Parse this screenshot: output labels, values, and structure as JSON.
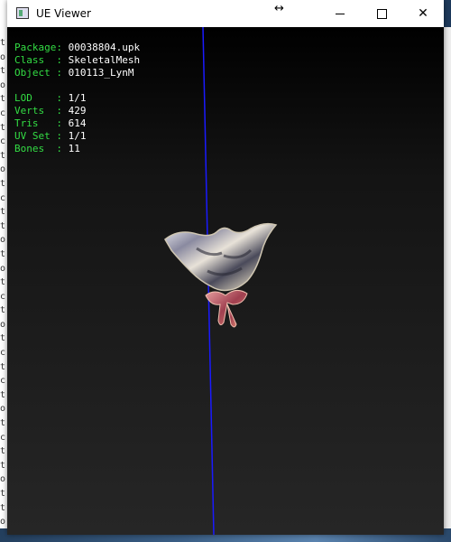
{
  "window": {
    "title": "UE Viewer",
    "controls": [
      "minimize",
      "maximize",
      "close"
    ]
  },
  "info_top": [
    {
      "key": "Package",
      "value": "00038804.upk"
    },
    {
      "key": "Class  ",
      "value": "SkeletalMesh"
    },
    {
      "key": "Object ",
      "value": "010113_LynM"
    }
  ],
  "info_stats": [
    {
      "key": "LOD    ",
      "value": "1/1"
    },
    {
      "key": "Verts  ",
      "value": "429"
    },
    {
      "key": "Tris   ",
      "value": "614"
    },
    {
      "key": "UV Set ",
      "value": "1/1"
    },
    {
      "key": "Bones  ",
      "value": "11"
    }
  ],
  "background_chars": [
    "t",
    "o",
    "t",
    "o",
    "t",
    "c",
    "t",
    "c",
    "t",
    "o",
    "t",
    "c",
    "t",
    "t",
    "o",
    "t",
    "o",
    "t",
    "c",
    "t",
    "o",
    "t",
    "c",
    "t",
    "c",
    "t",
    "o",
    "t",
    "c",
    "t",
    "t",
    "o",
    "t",
    "t",
    "o"
  ],
  "colors": {
    "label": "#33dd44",
    "value": "#ffffff",
    "axis": "#1a1aff"
  }
}
